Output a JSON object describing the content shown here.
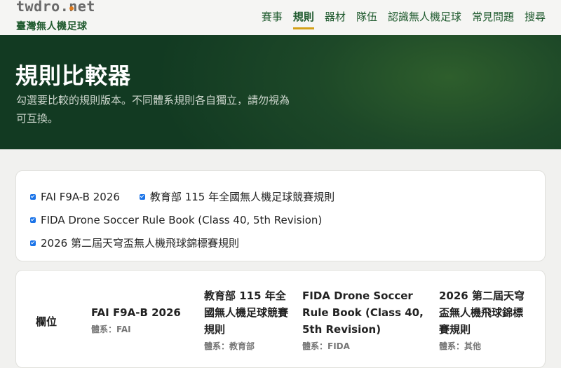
{
  "brand": {
    "logo": "twdro.net",
    "subtitle": "臺灣無人機足球"
  },
  "nav": [
    {
      "label": "賽事",
      "active": false
    },
    {
      "label": "規則",
      "active": true
    },
    {
      "label": "器材",
      "active": false
    },
    {
      "label": "隊伍",
      "active": false
    },
    {
      "label": "認識無人機足球",
      "active": false
    },
    {
      "label": "常見問題",
      "active": false
    },
    {
      "label": "搜尋",
      "active": false
    }
  ],
  "hero": {
    "title": "規則比較器",
    "description": "勾選要比較的規則版本。不同體系規則各自獨立，請勿視為可互換。"
  },
  "rule_options": [
    {
      "label": "FAI F9A-B 2026",
      "checked": true
    },
    {
      "label": "教育部 115 年全國無人機足球競賽規則",
      "checked": true
    },
    {
      "label": "FIDA Drone Soccer Rule Book (Class 40, 5th Revision)",
      "checked": true
    },
    {
      "label": "2026 第二屆天穹盃無人機飛球錦標賽規則",
      "checked": true
    }
  ],
  "table": {
    "field_header": "欄位",
    "columns": [
      {
        "title": "FAI F9A-B 2026",
        "system": "體系：FAI"
      },
      {
        "title": "教育部 115 年全國無人機足球競賽規則",
        "system": "體系：教育部"
      },
      {
        "title": "FIDA Drone Soccer Rule Book (Class 40, 5th Revision)",
        "system": "體系：FIDA"
      },
      {
        "title": "2026 第二屆天穹盃無人機飛球錦標賽規則",
        "system": "體系：其他"
      }
    ]
  },
  "colors": {
    "accent_green": "#1f5a2e",
    "active_underline": "#d4a017",
    "checkbox": "#1a73e8"
  }
}
